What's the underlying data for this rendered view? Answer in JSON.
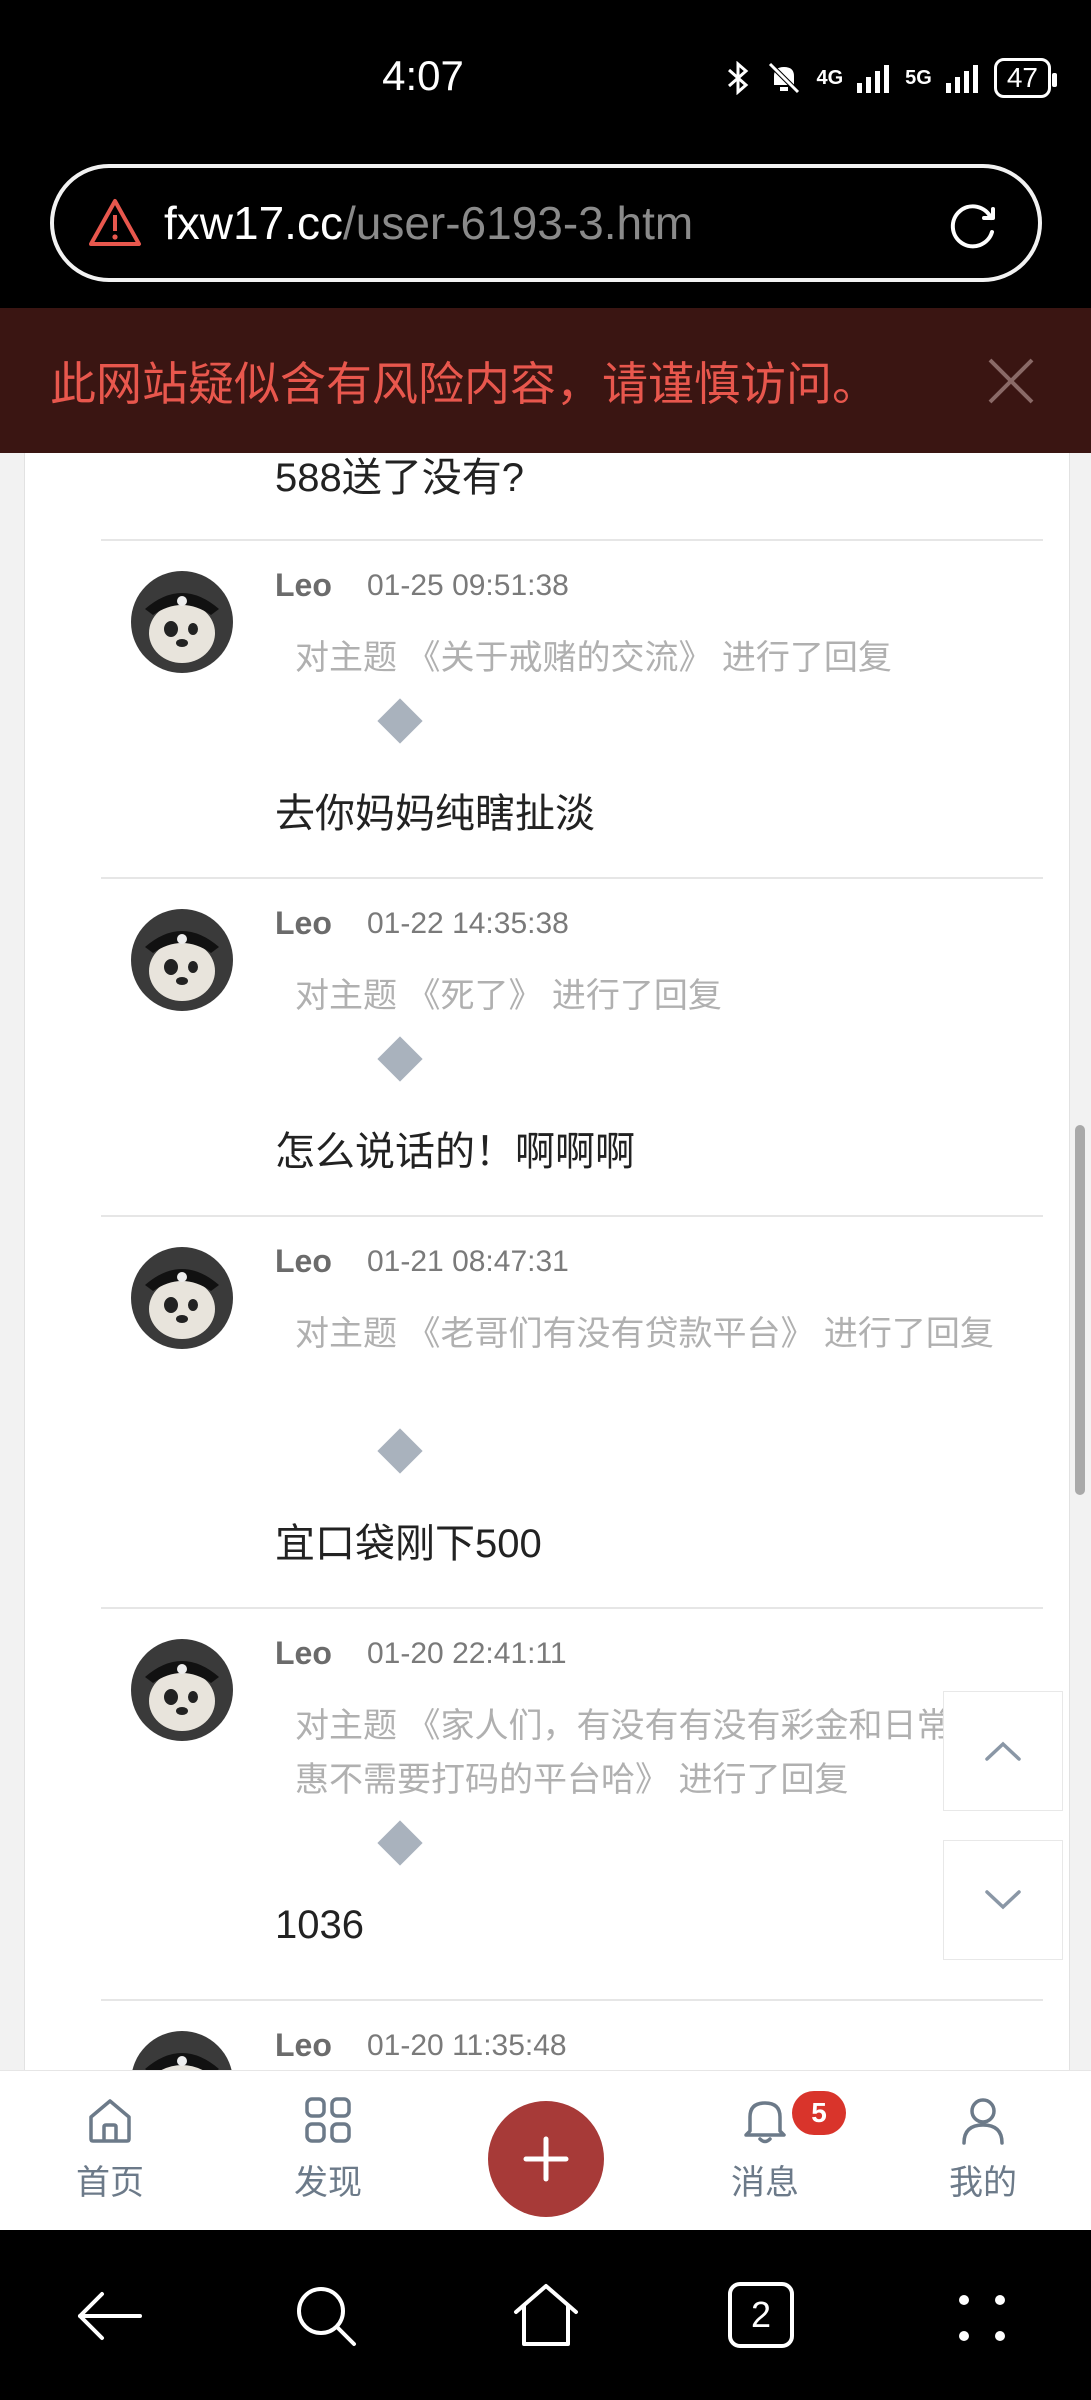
{
  "status": {
    "time": "4:07",
    "network_4g": "4G",
    "network_5g": "5G",
    "battery": "47"
  },
  "browser": {
    "url_domain": "fxw17.cc",
    "url_path": "/user-6193-3.htm"
  },
  "warning": {
    "text": "此网站疑似含有风险内容，请谨慎访问。"
  },
  "feed": {
    "previous_tail": "588送了没有?",
    "replies": [
      {
        "user": "Leo",
        "time": "01-25 09:51:38",
        "topic": "对主题 《关于戒赌的交流》 进行了回复",
        "text": "去你妈妈纯瞎扯淡"
      },
      {
        "user": "Leo",
        "time": "01-22 14:35:38",
        "topic": "对主题 《死了》 进行了回复",
        "text": "怎么说话的！啊啊啊"
      },
      {
        "user": "Leo",
        "time": "01-21 08:47:31",
        "topic": "对主题 《老哥们有没有贷款平台》 进行了回复",
        "text": "宜口袋刚下500"
      },
      {
        "user": "Leo",
        "time": "01-20 22:41:11",
        "topic": "对主题 《家人们，有没有有没有彩金和日常优惠不需要打码的平台哈》 进行了回复",
        "text": "1036"
      },
      {
        "user": "Leo",
        "time": "01-20 11:35:48",
        "topic": "",
        "text": ""
      }
    ]
  },
  "tabbar": {
    "home": "首页",
    "discover": "发现",
    "messages": "消息",
    "messages_badge": "5",
    "mine": "我的"
  },
  "navbar": {
    "tabs_count": "2"
  }
}
